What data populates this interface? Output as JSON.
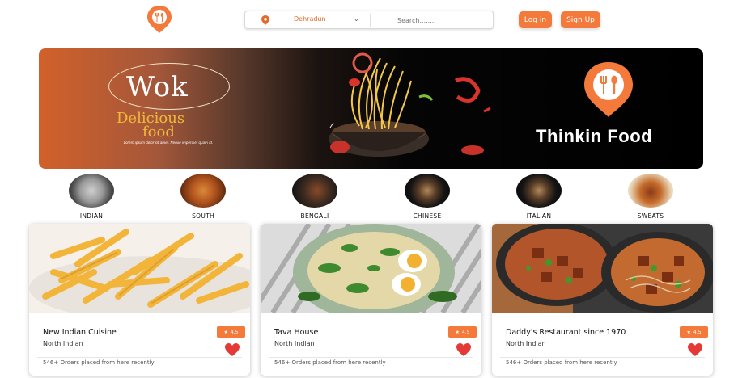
{
  "header": {
    "location": "Dehradun",
    "search_placeholder": "Search.......",
    "login_label": "Log in",
    "signup_label": "Sign Up"
  },
  "banner": {
    "headline": "Wok",
    "subline_1": "Delicious",
    "subline_2": "food",
    "tagline": "Lorem ipsum dolor sit amet. Neque imperdiet quam id.",
    "brand": "Thinkin Food"
  },
  "categories": [
    {
      "label": "INDIAN"
    },
    {
      "label": "SOUTH"
    },
    {
      "label": "BENGALI"
    },
    {
      "label": "CHINESE"
    },
    {
      "label": "ITALIAN"
    },
    {
      "label": "SWEATS"
    }
  ],
  "restaurants": [
    {
      "name": "New Indian Cuisine",
      "cuisine": "North Indian",
      "rating": "4.5",
      "orders": "546+ Orders placed from here recently"
    },
    {
      "name": "Tava House",
      "cuisine": "North Indian",
      "rating": "4.5",
      "orders": "546+ Orders placed from here recently"
    },
    {
      "name": "Daddy's Restaurant since 1970",
      "cuisine": "North Indian",
      "rating": "4.5",
      "orders": "546+ Orders placed from here recently"
    }
  ],
  "colors": {
    "accent": "#f47a3c",
    "heart": "#e53935"
  },
  "icons": [
    "logo-icon",
    "location-pin-icon",
    "chevron-down-icon",
    "star-icon",
    "heart-icon"
  ]
}
